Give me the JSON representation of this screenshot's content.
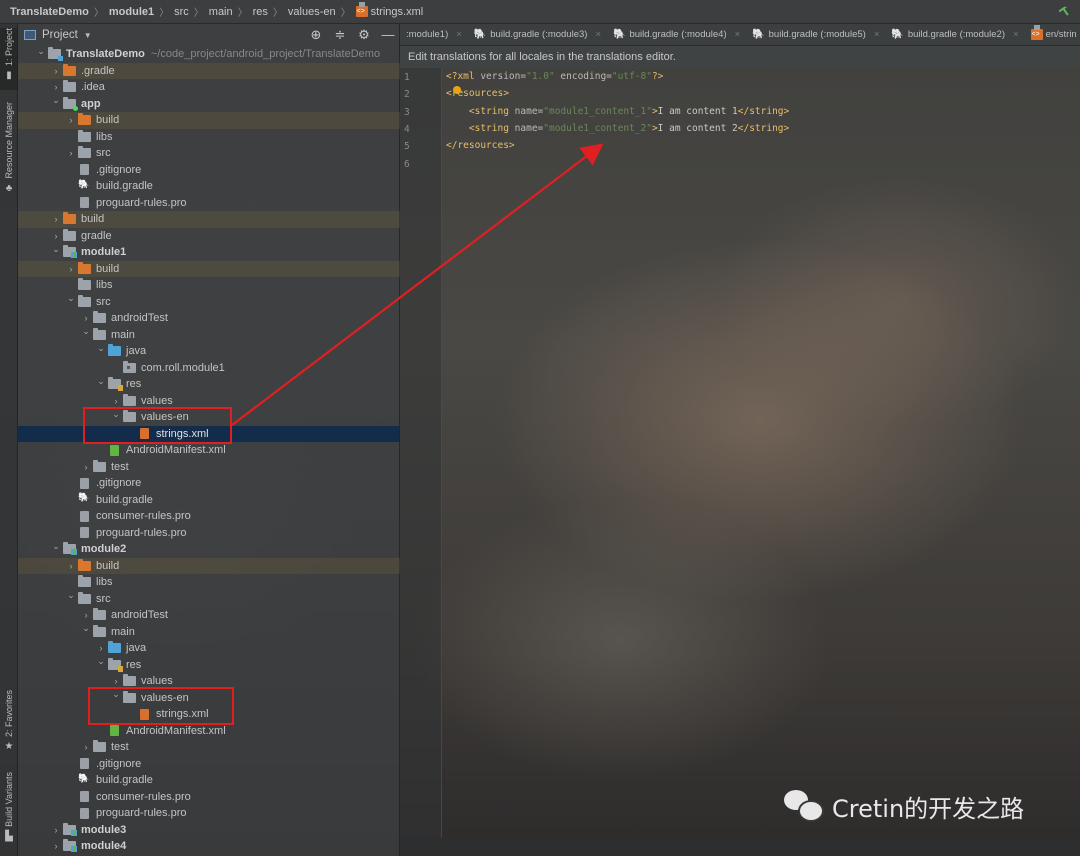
{
  "breadcrumb": [
    "TranslateDemo",
    "module1",
    "src",
    "main",
    "res",
    "values-en",
    "strings.xml"
  ],
  "tool_stripe": {
    "top_tabs": [
      {
        "label": "1: Project",
        "icon": "folder-icon",
        "active": true
      },
      {
        "label": "Resource Manager",
        "icon": "resource-manager-icon",
        "active": false
      }
    ],
    "bottom_tabs": [
      {
        "label": "2: Favorites",
        "icon": "star-icon"
      },
      {
        "label": "Build Variants",
        "icon": "build-variants-icon"
      }
    ]
  },
  "project_panel": {
    "title": "Project",
    "tools": [
      "locate-icon",
      "collapse-icon",
      "gear-icon",
      "minimize-icon"
    ],
    "tree": [
      {
        "depth": 0,
        "arrow": "down",
        "icon": "root",
        "label": "TranslateDemo",
        "bold": true,
        "path": "~/code_project/android_project/TranslateDemo"
      },
      {
        "depth": 1,
        "arrow": "right",
        "icon": "orange",
        "label": ".gradle",
        "hl": true
      },
      {
        "depth": 1,
        "arrow": "right",
        "icon": "folder",
        "label": ".idea"
      },
      {
        "depth": 1,
        "arrow": "down",
        "icon": "app",
        "label": "app",
        "bold": true
      },
      {
        "depth": 2,
        "arrow": "right",
        "icon": "orange",
        "label": "build",
        "hl": true
      },
      {
        "depth": 2,
        "arrow": "",
        "icon": "folder",
        "label": "libs"
      },
      {
        "depth": 2,
        "arrow": "right",
        "icon": "folder",
        "label": "src"
      },
      {
        "depth": 2,
        "arrow": "",
        "icon": "file",
        "label": ".gitignore"
      },
      {
        "depth": 2,
        "arrow": "",
        "icon": "gradle",
        "label": "build.gradle"
      },
      {
        "depth": 2,
        "arrow": "",
        "icon": "file",
        "label": "proguard-rules.pro"
      },
      {
        "depth": 1,
        "arrow": "right",
        "icon": "orange",
        "label": "build",
        "hl": true
      },
      {
        "depth": 1,
        "arrow": "right",
        "icon": "folder",
        "label": "gradle"
      },
      {
        "depth": 1,
        "arrow": "down",
        "icon": "module",
        "label": "module1",
        "bold": true
      },
      {
        "depth": 2,
        "arrow": "right",
        "icon": "orange",
        "label": "build",
        "hl": true
      },
      {
        "depth": 2,
        "arrow": "",
        "icon": "folder",
        "label": "libs"
      },
      {
        "depth": 2,
        "arrow": "down",
        "icon": "folder",
        "label": "src"
      },
      {
        "depth": 3,
        "arrow": "right",
        "icon": "folder",
        "label": "androidTest"
      },
      {
        "depth": 3,
        "arrow": "down",
        "icon": "folder",
        "label": "main"
      },
      {
        "depth": 4,
        "arrow": "down",
        "icon": "blue",
        "label": "java"
      },
      {
        "depth": 5,
        "arrow": "",
        "icon": "pkg",
        "label": "com.roll.module1"
      },
      {
        "depth": 4,
        "arrow": "down",
        "icon": "res",
        "label": "res"
      },
      {
        "depth": 5,
        "arrow": "right",
        "icon": "folder",
        "label": "values"
      },
      {
        "depth": 5,
        "arrow": "down",
        "icon": "folder",
        "label": "values-en"
      },
      {
        "depth": 6,
        "arrow": "",
        "icon": "xml",
        "label": "strings.xml",
        "selected": true
      },
      {
        "depth": 4,
        "arrow": "",
        "icon": "manifest",
        "label": "AndroidManifest.xml"
      },
      {
        "depth": 3,
        "arrow": "right",
        "icon": "folder",
        "label": "test"
      },
      {
        "depth": 2,
        "arrow": "",
        "icon": "file",
        "label": ".gitignore"
      },
      {
        "depth": 2,
        "arrow": "",
        "icon": "gradle",
        "label": "build.gradle"
      },
      {
        "depth": 2,
        "arrow": "",
        "icon": "file",
        "label": "consumer-rules.pro"
      },
      {
        "depth": 2,
        "arrow": "",
        "icon": "file",
        "label": "proguard-rules.pro"
      },
      {
        "depth": 1,
        "arrow": "down",
        "icon": "module",
        "label": "module2",
        "bold": true
      },
      {
        "depth": 2,
        "arrow": "right",
        "icon": "orange",
        "label": "build",
        "hl": true
      },
      {
        "depth": 2,
        "arrow": "",
        "icon": "folder",
        "label": "libs"
      },
      {
        "depth": 2,
        "arrow": "down",
        "icon": "folder",
        "label": "src"
      },
      {
        "depth": 3,
        "arrow": "right",
        "icon": "folder",
        "label": "androidTest"
      },
      {
        "depth": 3,
        "arrow": "down",
        "icon": "folder",
        "label": "main"
      },
      {
        "depth": 4,
        "arrow": "right",
        "icon": "blue",
        "label": "java"
      },
      {
        "depth": 4,
        "arrow": "down",
        "icon": "res",
        "label": "res"
      },
      {
        "depth": 5,
        "arrow": "right",
        "icon": "folder",
        "label": "values"
      },
      {
        "depth": 5,
        "arrow": "down",
        "icon": "folder",
        "label": "values-en"
      },
      {
        "depth": 6,
        "arrow": "",
        "icon": "xml",
        "label": "strings.xml"
      },
      {
        "depth": 4,
        "arrow": "",
        "icon": "manifest",
        "label": "AndroidManifest.xml"
      },
      {
        "depth": 3,
        "arrow": "right",
        "icon": "folder",
        "label": "test"
      },
      {
        "depth": 2,
        "arrow": "",
        "icon": "file",
        "label": ".gitignore"
      },
      {
        "depth": 2,
        "arrow": "",
        "icon": "gradle",
        "label": "build.gradle"
      },
      {
        "depth": 2,
        "arrow": "",
        "icon": "file",
        "label": "consumer-rules.pro"
      },
      {
        "depth": 2,
        "arrow": "",
        "icon": "file",
        "label": "proguard-rules.pro"
      },
      {
        "depth": 1,
        "arrow": "right",
        "icon": "module",
        "label": "module3",
        "bold": true
      },
      {
        "depth": 1,
        "arrow": "right",
        "icon": "module",
        "label": "module4",
        "bold": true
      }
    ]
  },
  "editor": {
    "tabs": [
      {
        "label": ":module1)",
        "icon": ""
      },
      {
        "label": "build.gradle (:module3)",
        "icon": "gradle-icon"
      },
      {
        "label": "build.gradle (:module4)",
        "icon": "gradle-icon"
      },
      {
        "label": "build.gradle (:module5)",
        "icon": "gradle-icon"
      },
      {
        "label": "build.gradle (:module2)",
        "icon": "gradle-icon"
      },
      {
        "label": "en/strin",
        "icon": "xml-file-icon"
      }
    ],
    "notice": "Edit translations for all locales in the translations editor.",
    "line_numbers": [
      "1",
      "2",
      "3",
      "4",
      "5",
      "6"
    ],
    "lines": [
      [
        {
          "t": "tag",
          "s": "<?xml "
        },
        {
          "t": "attr",
          "s": "version="
        },
        {
          "t": "val",
          "s": "\"1.0\""
        },
        {
          "t": "attr",
          "s": " encoding="
        },
        {
          "t": "val",
          "s": "\"utf-8\""
        },
        {
          "t": "tag",
          "s": "?>"
        }
      ],
      [
        {
          "t": "tag",
          "s": "<resources>"
        }
      ],
      [
        {
          "t": "txt",
          "s": "    "
        },
        {
          "t": "tag",
          "s": "<string "
        },
        {
          "t": "attr",
          "s": "name="
        },
        {
          "t": "val",
          "s": "\"module1_content_1\""
        },
        {
          "t": "tag",
          "s": ">"
        },
        {
          "t": "txt",
          "s": "I am content 1"
        },
        {
          "t": "tag",
          "s": "</string>"
        }
      ],
      [
        {
          "t": "txt",
          "s": "    "
        },
        {
          "t": "tag",
          "s": "<string "
        },
        {
          "t": "attr",
          "s": "name="
        },
        {
          "t": "val",
          "s": "\"module1_content_2\""
        },
        {
          "t": "tag",
          "s": ">"
        },
        {
          "t": "txt",
          "s": "I am content 2"
        },
        {
          "t": "tag",
          "s": "</string>"
        }
      ],
      [
        {
          "t": "tag",
          "s": "</resources>"
        }
      ],
      []
    ]
  },
  "watermark": "Cretin的开发之路",
  "colors": {
    "annotation_red": "#e02020",
    "selection_blue": "#0d294e",
    "xml_tag": "#e8bf6a",
    "xml_value": "#6a8759"
  }
}
